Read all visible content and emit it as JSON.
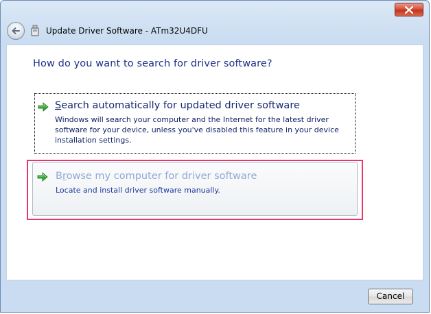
{
  "window": {
    "title": "Update Driver Software - ATm32U4DFU"
  },
  "content": {
    "heading": "How do you want to search for driver software?"
  },
  "options": [
    {
      "accel": "S",
      "title_rest": "earch automatically for updated driver software",
      "description": "Windows will search your computer and the Internet for the latest driver software for your device, unless you've disabled this feature in your device installation settings."
    },
    {
      "title_first": "B",
      "accel": "r",
      "title_rest": "owse my computer for driver software",
      "description": "Locate and install driver software manually."
    }
  ],
  "footer": {
    "cancel_label": "Cancel"
  },
  "icons": {
    "close": "close-icon",
    "back": "back-arrow-icon",
    "device": "device-icon",
    "option_arrow": "green-arrow-icon"
  }
}
